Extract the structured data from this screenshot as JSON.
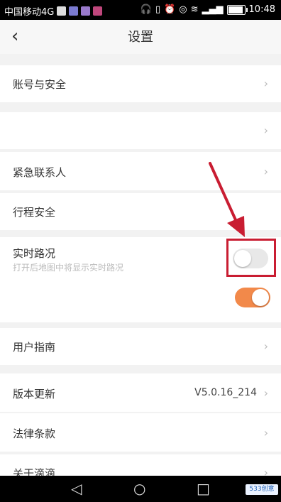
{
  "status_bar": {
    "carrier": "中国移动4G",
    "time": "10:48"
  },
  "header": {
    "title": "设置"
  },
  "rows": {
    "account_security": "账号与安全",
    "emergency_contact": "紧急联系人",
    "trip_safety": "行程安全",
    "realtime_traffic": "实时路况",
    "realtime_traffic_desc": "打开后地图中将显示实时路况",
    "user_guide": "用户指南",
    "version_update": "版本更新",
    "version_value": "V5.0.16_214",
    "legal_terms": "法律条款",
    "about": "关于滴滴"
  },
  "toggles": {
    "realtime_traffic_highlighted": {
      "state": "off"
    },
    "realtime_traffic_example": {
      "state": "on"
    }
  },
  "colors": {
    "toggle_on": "#f2894a",
    "toggle_off": "#e8e8e8",
    "highlight": "#c91d32"
  },
  "watermark": {
    "text": "533创意"
  }
}
